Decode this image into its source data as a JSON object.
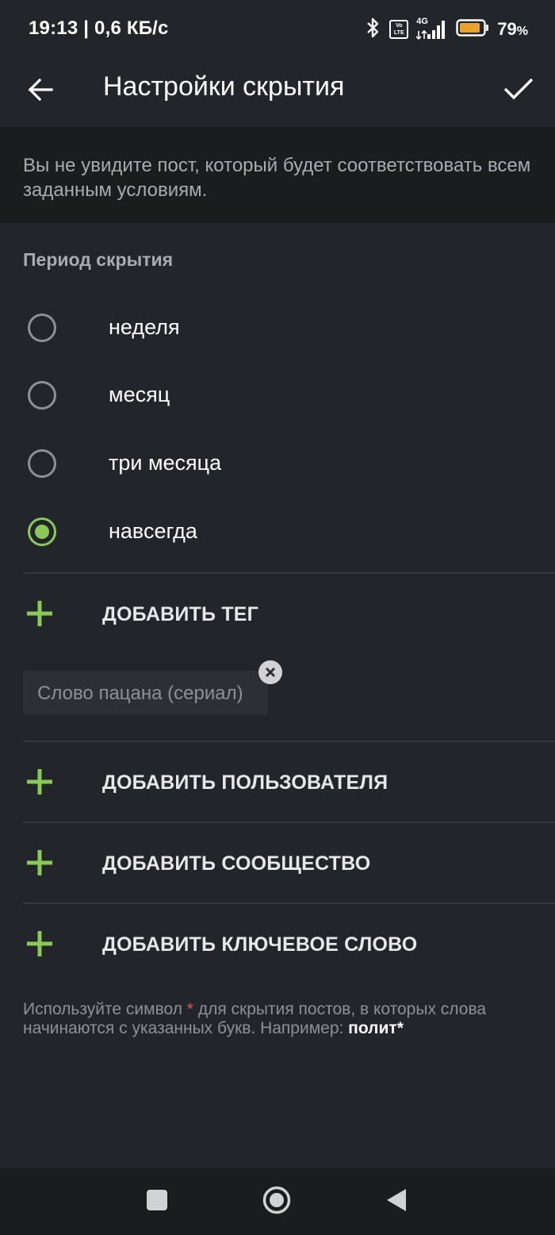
{
  "status_bar": {
    "time_speed": "19:13 | 0,6 КБ/с",
    "network": "4G",
    "volte": "Vo LTE",
    "battery_pct": "79",
    "battery_suffix": "%"
  },
  "app_bar": {
    "title": "Настройки скрытия"
  },
  "info_banner": {
    "text": "Вы не увидите пост, который будет соответствовать всем заданным условиям."
  },
  "period": {
    "title": "Период скрытия",
    "options": [
      {
        "label": "неделя",
        "checked": false
      },
      {
        "label": "месяц",
        "checked": false
      },
      {
        "label": "три месяца",
        "checked": false
      },
      {
        "label": "навсегда",
        "checked": true
      }
    ]
  },
  "actions": {
    "add_tag": "ДОБАВИТЬ ТЕГ",
    "add_user": "ДОБАВИТЬ ПОЛЬЗОВАТЕЛЯ",
    "add_community": "ДОБАВИТЬ СООБЩЕСТВО",
    "add_keyword": "ДОБАВИТЬ КЛЮЧЕВОЕ СЛОВО"
  },
  "tags": [
    {
      "label": "Слово пацана (сериал)"
    }
  ],
  "hint": {
    "part1": "Используйте символ ",
    "star": "*",
    "part2": " для скрытия постов, в которых слова начинаются с указанных букв. Например: ",
    "example": "полит*"
  },
  "colors": {
    "background": "#22262b",
    "banner": "#1b1c1e",
    "accent": "#8ac858",
    "star": "#e2574c"
  }
}
